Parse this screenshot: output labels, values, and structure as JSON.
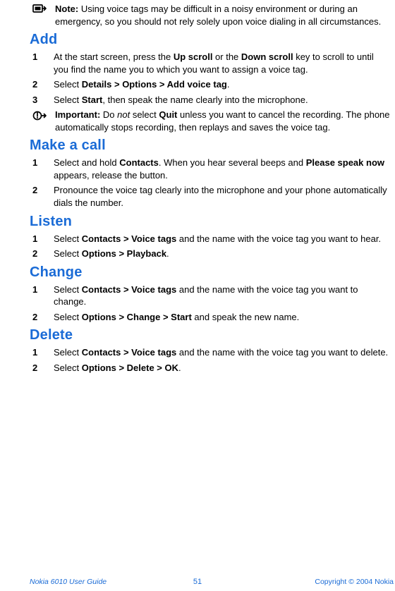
{
  "note": {
    "label": "Note:",
    "text": " Using voice tags may be difficult in a noisy environment or during an emergency, so you should not rely solely upon voice dialing in all circumstances."
  },
  "sections": {
    "add": {
      "title": "Add",
      "steps": [
        {
          "num": "1",
          "pre": "At the start screen, press the ",
          "b1": "Up scroll",
          "mid": " or the ",
          "b2": "Down scroll",
          "post": " key to scroll to until you find the name you to which you want to assign a voice tag."
        },
        {
          "num": "2",
          "pre": "Select ",
          "b1": "Details > Options > Add voice tag",
          "post": "."
        },
        {
          "num": "3",
          "pre": "Select ",
          "b1": "Start",
          "post": ", then speak the name clearly into the microphone."
        }
      ]
    },
    "important": {
      "label": "Important:",
      "pre": " Do ",
      "ital": "not",
      "mid": " select ",
      "b1": "Quit",
      "post": " unless you want to cancel the recording. The phone automatically stops recording, then replays and saves the voice tag."
    },
    "makeCall": {
      "title": "Make a call",
      "steps": [
        {
          "num": "1",
          "pre": "Select and hold ",
          "b1": "Contacts",
          "mid": ". When you hear several beeps and ",
          "b2": "Please speak now",
          "post": " appears, release the button."
        },
        {
          "num": "2",
          "pre": "Pronounce the voice tag clearly into the microphone and your phone automatically dials the number."
        }
      ]
    },
    "listen": {
      "title": "Listen",
      "steps": [
        {
          "num": "1",
          "pre": "Select ",
          "b1": "Contacts > Voice tags",
          "post": " and the name with the voice tag you want to hear."
        },
        {
          "num": "2",
          "pre": "Select ",
          "b1": "Options > Playback",
          "post": "."
        }
      ]
    },
    "change": {
      "title": "Change",
      "steps": [
        {
          "num": "1",
          "pre": "Select ",
          "b1": "Contacts > Voice tags",
          "post": " and the name with the voice tag you want to change."
        },
        {
          "num": "2",
          "pre": "Select ",
          "b1": "Options > Change > Start",
          "post": " and speak the new name."
        }
      ]
    },
    "delete": {
      "title": "Delete",
      "steps": [
        {
          "num": "1",
          "pre": "Select ",
          "b1": "Contacts > Voice tags",
          "post": " and the name with the voice tag you want to delete."
        },
        {
          "num": "2",
          "pre": "Select ",
          "b1": "Options > Delete > OK",
          "post": "."
        }
      ]
    }
  },
  "footer": {
    "left": "Nokia 6010 User Guide",
    "center": "51",
    "right": "Copyright © 2004 Nokia"
  }
}
